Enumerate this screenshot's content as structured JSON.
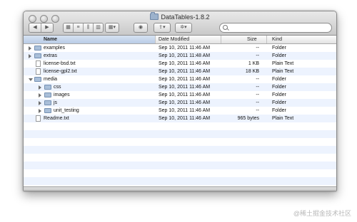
{
  "window": {
    "title": "DataTables-1.8.2"
  },
  "toolbar": {
    "back_icon": "chevron-left-icon",
    "forward_icon": "chevron-right-icon",
    "view_icons": [
      "icon-view-icon",
      "list-view-icon",
      "column-view-icon",
      "coverflow-view-icon"
    ],
    "arrange_icon": "arrange-icon",
    "quicklook_icon": "eye-icon",
    "share_icon": "share-icon",
    "action_icon": "gear-icon",
    "search": {
      "placeholder": "",
      "value": ""
    }
  },
  "columns": {
    "name": "Name",
    "date": "Date Modified",
    "size": "Size",
    "kind": "Kind"
  },
  "files": [
    {
      "name": "examples",
      "date": "Sep 10, 2011 11:46 AM",
      "size": "--",
      "kind": "Folder",
      "type": "folder",
      "level": 0,
      "expanded": false
    },
    {
      "name": "extras",
      "date": "Sep 10, 2011 11:48 AM",
      "size": "--",
      "kind": "Folder",
      "type": "folder",
      "level": 0,
      "expanded": false
    },
    {
      "name": "license-bsd.txt",
      "date": "Sep 10, 2011 11:46 AM",
      "size": "1 KB",
      "kind": "Plain Text",
      "type": "file",
      "level": 0
    },
    {
      "name": "license-gpl2.txt",
      "date": "Sep 10, 2011 11:46 AM",
      "size": "18 KB",
      "kind": "Plain Text",
      "type": "file",
      "level": 0
    },
    {
      "name": "media",
      "date": "Sep 10, 2011 11:46 AM",
      "size": "--",
      "kind": "Folder",
      "type": "folder",
      "level": 0,
      "expanded": true
    },
    {
      "name": "css",
      "date": "Sep 10, 2011 11:46 AM",
      "size": "--",
      "kind": "Folder",
      "type": "folder",
      "level": 1,
      "expanded": false
    },
    {
      "name": "images",
      "date": "Sep 10, 2011 11:46 AM",
      "size": "--",
      "kind": "Folder",
      "type": "folder",
      "level": 1,
      "expanded": false
    },
    {
      "name": "js",
      "date": "Sep 10, 2011 11:46 AM",
      "size": "--",
      "kind": "Folder",
      "type": "folder",
      "level": 1,
      "expanded": false
    },
    {
      "name": "unit_testing",
      "date": "Sep 10, 2011 11:46 AM",
      "size": "--",
      "kind": "Folder",
      "type": "folder",
      "level": 1,
      "expanded": false
    },
    {
      "name": "Readme.txt",
      "date": "Sep 10, 2011 11:46 AM",
      "size": "965 bytes",
      "kind": "Plain Text",
      "type": "file",
      "level": 0
    }
  ],
  "empty_rows": 10,
  "watermark": "@稀土掘金技术社区"
}
